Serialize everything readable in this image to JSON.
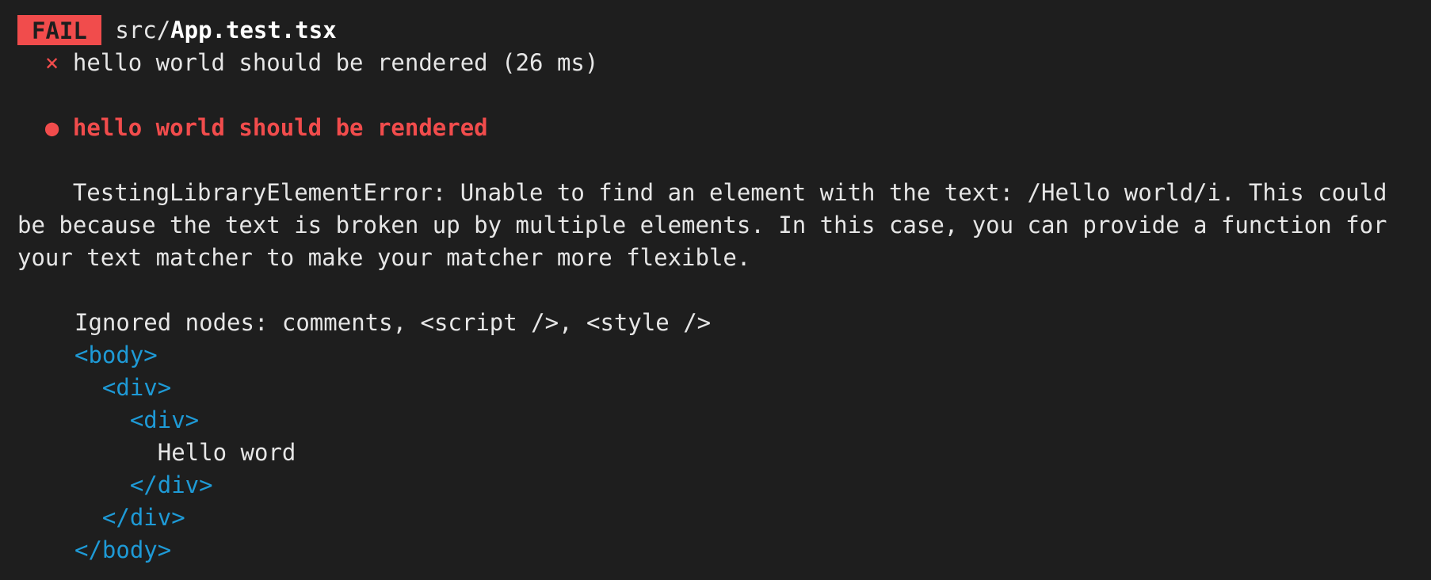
{
  "header": {
    "badge": "FAIL",
    "path_dir": "src/",
    "path_file": "App.test.tsx"
  },
  "test_result": {
    "marker": "×",
    "label": "hello world should be rendered (26 ms)"
  },
  "failure": {
    "bullet": "●",
    "title": "hello world should be rendered"
  },
  "error": {
    "indent": "    ",
    "message": "TestingLibraryElementError: Unable to find an element with the text: /Hello world/i. This could be because the text is broken up by multiple elements. In this case, you can provide a function for your text matcher to make your matcher more flexible."
  },
  "dom_dump": {
    "ignored_nodes": "Ignored nodes: comments, <script />, <style />",
    "lines": [
      {
        "indent": "",
        "text": "<body>",
        "kind": "tag"
      },
      {
        "indent": "  ",
        "text": "<div>",
        "kind": "tag"
      },
      {
        "indent": "    ",
        "text": "<div>",
        "kind": "tag"
      },
      {
        "indent": "      ",
        "text": "Hello word",
        "kind": "text"
      },
      {
        "indent": "    ",
        "text": "</div>",
        "kind": "tag"
      },
      {
        "indent": "  ",
        "text": "</div>",
        "kind": "tag"
      },
      {
        "indent": "",
        "text": "</body>",
        "kind": "tag"
      }
    ]
  },
  "colors": {
    "background": "#1e1e1e",
    "fail": "#f14c4c",
    "tag": "#1e9ad6",
    "text": "#e6e6e6"
  }
}
